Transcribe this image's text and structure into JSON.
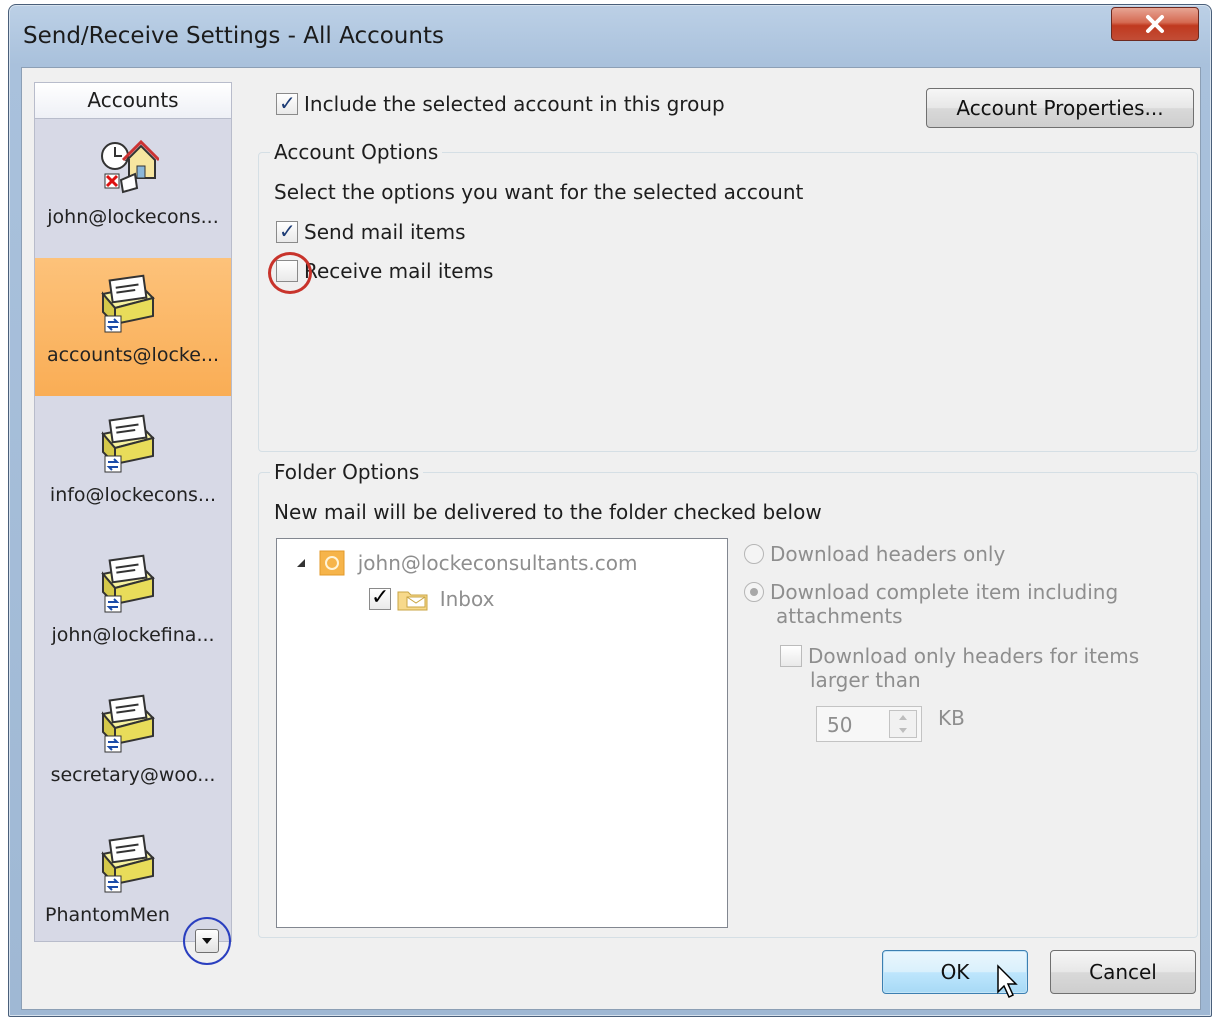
{
  "window": {
    "title": "Send/Receive Settings - All Accounts"
  },
  "accounts": {
    "header": "Accounts",
    "items": [
      {
        "label": "john@lockecons...",
        "icon": "offline-house-icon",
        "selected": false
      },
      {
        "label": "accounts@locke...",
        "icon": "mail-sync-icon",
        "selected": true
      },
      {
        "label": "info@lockecons...",
        "icon": "mail-sync-icon",
        "selected": false
      },
      {
        "label": "john@lockefina...",
        "icon": "mail-sync-icon",
        "selected": false
      },
      {
        "label": "secretary@woo...",
        "icon": "mail-sync-icon",
        "selected": false
      },
      {
        "label": "PhantomMen",
        "icon": "mail-sync-icon",
        "selected": false
      }
    ]
  },
  "include_group": {
    "label": "Include the selected account in this group",
    "checked": true
  },
  "account_properties_button": "Account Properties...",
  "account_options": {
    "title": "Account Options",
    "description": "Select the options you want for the selected account",
    "send_mail": {
      "label": "Send mail items",
      "checked": true
    },
    "receive_mail": {
      "label": "Receive mail items",
      "checked": false
    }
  },
  "folder_options": {
    "title": "Folder Options",
    "description": "New mail will be delivered to the folder checked below",
    "tree": {
      "root": "john@lockeconsultants.com",
      "child": "Inbox",
      "child_checked": true
    },
    "download_headers_only": "Download headers only",
    "download_complete": "Download complete item including",
    "download_complete_line2": "attachments",
    "download_only_headers_large": "Download only headers for items",
    "download_only_headers_large_line2": "larger than",
    "size_value": "50",
    "size_unit": "KB"
  },
  "buttons": {
    "ok": "OK",
    "cancel": "Cancel"
  },
  "colors": {
    "selected_account": "#f9ad55",
    "accent_blue": "#3c7fb1",
    "annotation_red": "#c8332b",
    "annotation_blue": "#2a3fbf"
  }
}
